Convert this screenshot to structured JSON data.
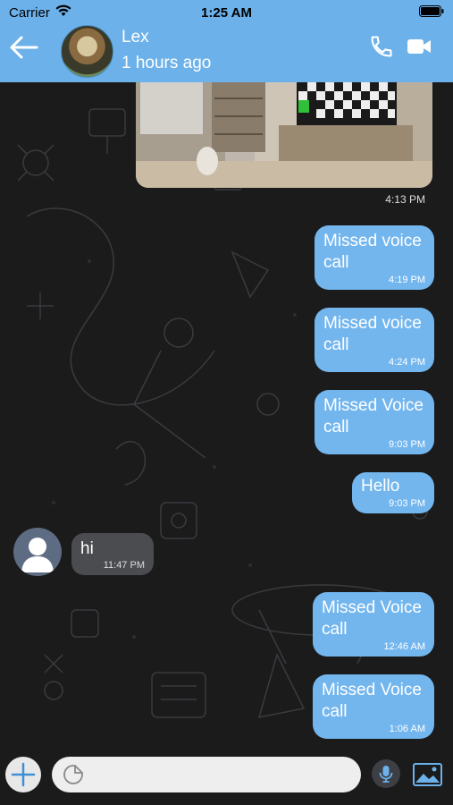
{
  "status_bar": {
    "carrier": "Carrier",
    "time": "1:25 AM"
  },
  "header": {
    "contact_name": "Lex",
    "presence": "1 hours ago",
    "icons": [
      "back-arrow-icon",
      "phone-icon",
      "video-camera-icon"
    ]
  },
  "messages": [
    {
      "type": "photo",
      "direction": "outgoing",
      "time": "4:13 PM"
    },
    {
      "type": "text",
      "direction": "outgoing",
      "text": "Missed voice call",
      "time": "4:19 PM"
    },
    {
      "type": "text",
      "direction": "outgoing",
      "text": "Missed voice call",
      "time": "4:24 PM"
    },
    {
      "type": "text",
      "direction": "outgoing",
      "text": "Missed Voice call",
      "time": "9:03 PM"
    },
    {
      "type": "text",
      "direction": "outgoing",
      "text": "Hello",
      "time": "9:03 PM"
    },
    {
      "type": "text",
      "direction": "incoming",
      "text": "hi",
      "time": "11:47 PM"
    },
    {
      "type": "text",
      "direction": "outgoing",
      "text": "Missed Voice call",
      "time": "12:46 AM"
    },
    {
      "type": "text",
      "direction": "outgoing",
      "text": "Missed Voice call",
      "time": "1:06 AM"
    }
  ],
  "composer": {
    "placeholder": "",
    "icons": [
      "plus-icon",
      "sticker-icon",
      "microphone-icon",
      "gallery-icon"
    ]
  },
  "colors": {
    "header_bg": "#6cb1ea",
    "outgoing_bubble": "#73b6ee",
    "incoming_bubble": "#4a4c50",
    "chat_bg": "#1b1b1c"
  }
}
